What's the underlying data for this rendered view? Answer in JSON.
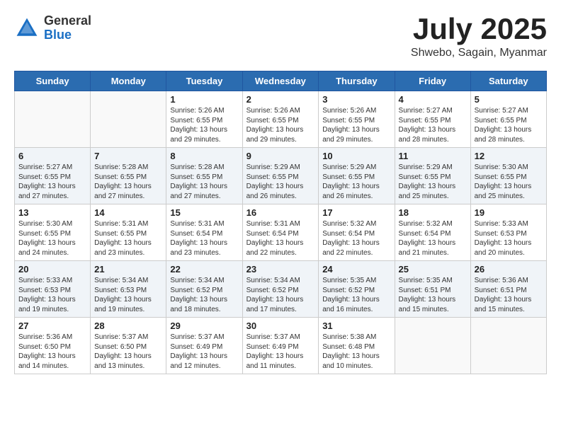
{
  "header": {
    "logo_general": "General",
    "logo_blue": "Blue",
    "month_title": "July 2025",
    "subtitle": "Shwebo, Sagain, Myanmar"
  },
  "days_of_week": [
    "Sunday",
    "Monday",
    "Tuesday",
    "Wednesday",
    "Thursday",
    "Friday",
    "Saturday"
  ],
  "weeks": [
    [
      {
        "day": "",
        "content": ""
      },
      {
        "day": "",
        "content": ""
      },
      {
        "day": "1",
        "content": "Sunrise: 5:26 AM\nSunset: 6:55 PM\nDaylight: 13 hours\nand 29 minutes."
      },
      {
        "day": "2",
        "content": "Sunrise: 5:26 AM\nSunset: 6:55 PM\nDaylight: 13 hours\nand 29 minutes."
      },
      {
        "day": "3",
        "content": "Sunrise: 5:26 AM\nSunset: 6:55 PM\nDaylight: 13 hours\nand 29 minutes."
      },
      {
        "day": "4",
        "content": "Sunrise: 5:27 AM\nSunset: 6:55 PM\nDaylight: 13 hours\nand 28 minutes."
      },
      {
        "day": "5",
        "content": "Sunrise: 5:27 AM\nSunset: 6:55 PM\nDaylight: 13 hours\nand 28 minutes."
      }
    ],
    [
      {
        "day": "6",
        "content": "Sunrise: 5:27 AM\nSunset: 6:55 PM\nDaylight: 13 hours\nand 27 minutes."
      },
      {
        "day": "7",
        "content": "Sunrise: 5:28 AM\nSunset: 6:55 PM\nDaylight: 13 hours\nand 27 minutes."
      },
      {
        "day": "8",
        "content": "Sunrise: 5:28 AM\nSunset: 6:55 PM\nDaylight: 13 hours\nand 27 minutes."
      },
      {
        "day": "9",
        "content": "Sunrise: 5:29 AM\nSunset: 6:55 PM\nDaylight: 13 hours\nand 26 minutes."
      },
      {
        "day": "10",
        "content": "Sunrise: 5:29 AM\nSunset: 6:55 PM\nDaylight: 13 hours\nand 26 minutes."
      },
      {
        "day": "11",
        "content": "Sunrise: 5:29 AM\nSunset: 6:55 PM\nDaylight: 13 hours\nand 25 minutes."
      },
      {
        "day": "12",
        "content": "Sunrise: 5:30 AM\nSunset: 6:55 PM\nDaylight: 13 hours\nand 25 minutes."
      }
    ],
    [
      {
        "day": "13",
        "content": "Sunrise: 5:30 AM\nSunset: 6:55 PM\nDaylight: 13 hours\nand 24 minutes."
      },
      {
        "day": "14",
        "content": "Sunrise: 5:31 AM\nSunset: 6:55 PM\nDaylight: 13 hours\nand 23 minutes."
      },
      {
        "day": "15",
        "content": "Sunrise: 5:31 AM\nSunset: 6:54 PM\nDaylight: 13 hours\nand 23 minutes."
      },
      {
        "day": "16",
        "content": "Sunrise: 5:31 AM\nSunset: 6:54 PM\nDaylight: 13 hours\nand 22 minutes."
      },
      {
        "day": "17",
        "content": "Sunrise: 5:32 AM\nSunset: 6:54 PM\nDaylight: 13 hours\nand 22 minutes."
      },
      {
        "day": "18",
        "content": "Sunrise: 5:32 AM\nSunset: 6:54 PM\nDaylight: 13 hours\nand 21 minutes."
      },
      {
        "day": "19",
        "content": "Sunrise: 5:33 AM\nSunset: 6:53 PM\nDaylight: 13 hours\nand 20 minutes."
      }
    ],
    [
      {
        "day": "20",
        "content": "Sunrise: 5:33 AM\nSunset: 6:53 PM\nDaylight: 13 hours\nand 19 minutes."
      },
      {
        "day": "21",
        "content": "Sunrise: 5:34 AM\nSunset: 6:53 PM\nDaylight: 13 hours\nand 19 minutes."
      },
      {
        "day": "22",
        "content": "Sunrise: 5:34 AM\nSunset: 6:52 PM\nDaylight: 13 hours\nand 18 minutes."
      },
      {
        "day": "23",
        "content": "Sunrise: 5:34 AM\nSunset: 6:52 PM\nDaylight: 13 hours\nand 17 minutes."
      },
      {
        "day": "24",
        "content": "Sunrise: 5:35 AM\nSunset: 6:52 PM\nDaylight: 13 hours\nand 16 minutes."
      },
      {
        "day": "25",
        "content": "Sunrise: 5:35 AM\nSunset: 6:51 PM\nDaylight: 13 hours\nand 15 minutes."
      },
      {
        "day": "26",
        "content": "Sunrise: 5:36 AM\nSunset: 6:51 PM\nDaylight: 13 hours\nand 15 minutes."
      }
    ],
    [
      {
        "day": "27",
        "content": "Sunrise: 5:36 AM\nSunset: 6:50 PM\nDaylight: 13 hours\nand 14 minutes."
      },
      {
        "day": "28",
        "content": "Sunrise: 5:37 AM\nSunset: 6:50 PM\nDaylight: 13 hours\nand 13 minutes."
      },
      {
        "day": "29",
        "content": "Sunrise: 5:37 AM\nSunset: 6:49 PM\nDaylight: 13 hours\nand 12 minutes."
      },
      {
        "day": "30",
        "content": "Sunrise: 5:37 AM\nSunset: 6:49 PM\nDaylight: 13 hours\nand 11 minutes."
      },
      {
        "day": "31",
        "content": "Sunrise: 5:38 AM\nSunset: 6:48 PM\nDaylight: 13 hours\nand 10 minutes."
      },
      {
        "day": "",
        "content": ""
      },
      {
        "day": "",
        "content": ""
      }
    ]
  ]
}
